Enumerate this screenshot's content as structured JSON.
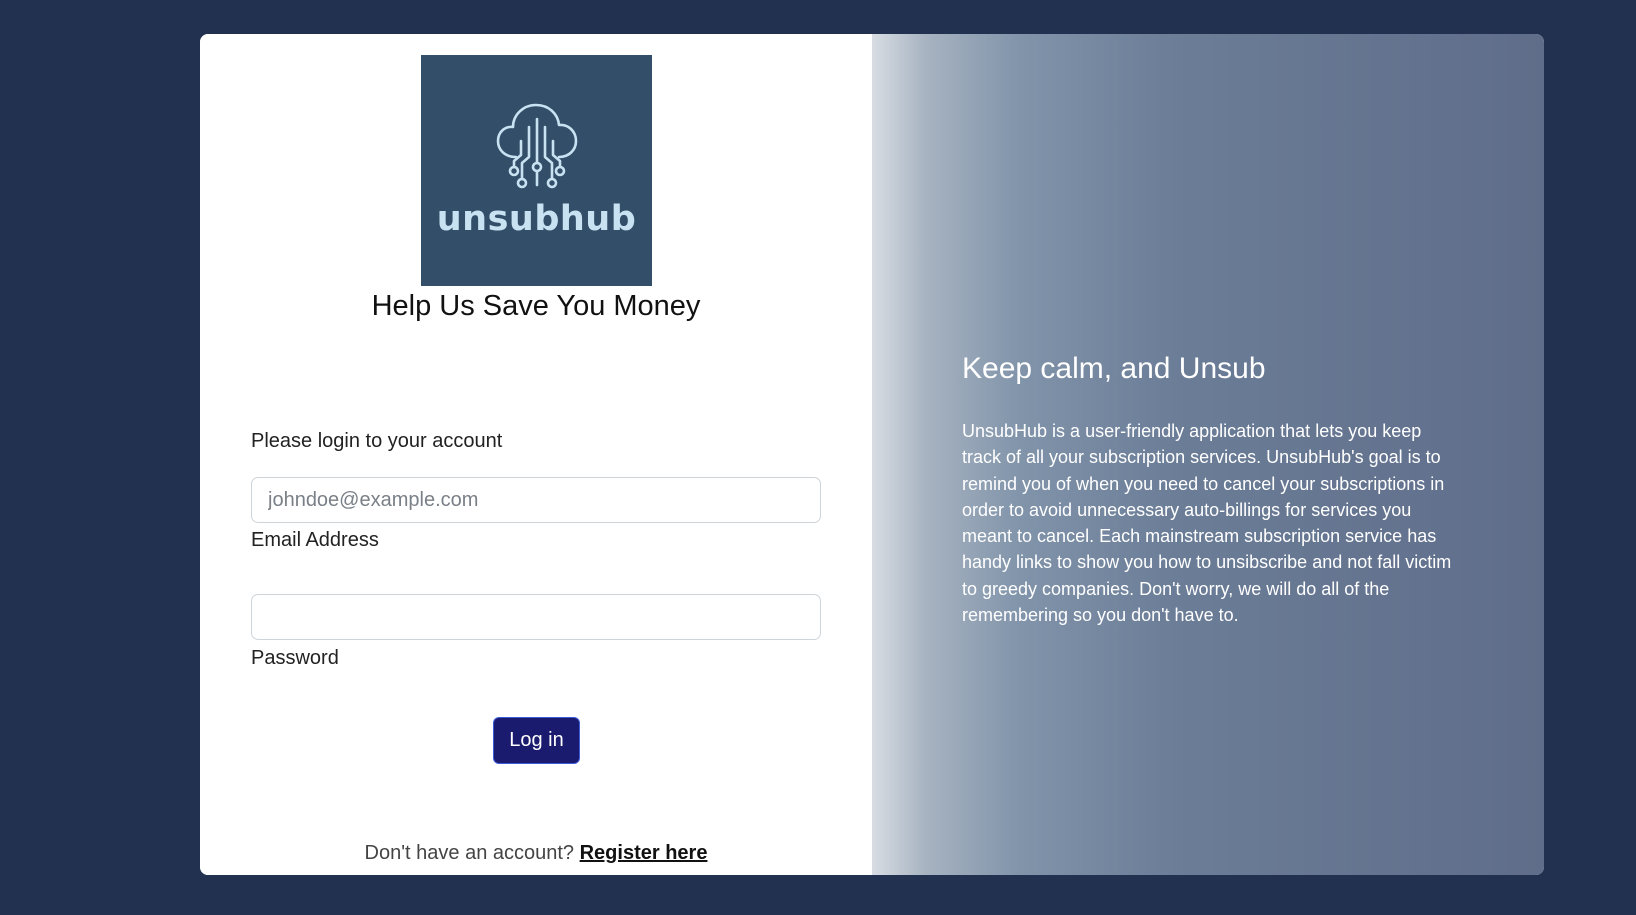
{
  "brand": {
    "logo_text": "unsubhub",
    "logo_bg_color": "#334e69",
    "logo_text_color": "#c8e2f2"
  },
  "login": {
    "headline": "Help Us Save You Money",
    "prompt": "Please login to your account",
    "email": {
      "placeholder": "johndoe@example.com",
      "value": "",
      "label": "Email Address"
    },
    "password": {
      "placeholder": "",
      "value": "",
      "label": "Password"
    },
    "login_button_label": "Log in",
    "register_prompt": "Don't have an account?",
    "register_link_label": "Register here"
  },
  "info": {
    "title": "Keep calm, and Unsub",
    "body": "UnsubHub is a user-friendly application that lets you keep track of all your subscription services. UnsubHub's goal is to remind you of when you need to cancel your subscriptions in order to avoid unnecessary auto-billings for services you meant to cancel. Each mainstream subscription service has handy links to show you how to unsibscribe and not fall victim to greedy companies. Don't worry, we will do all of the remembering so you don't have to."
  },
  "colors": {
    "page_bg": "#22314f",
    "button_bg": "#1a1a6e"
  }
}
